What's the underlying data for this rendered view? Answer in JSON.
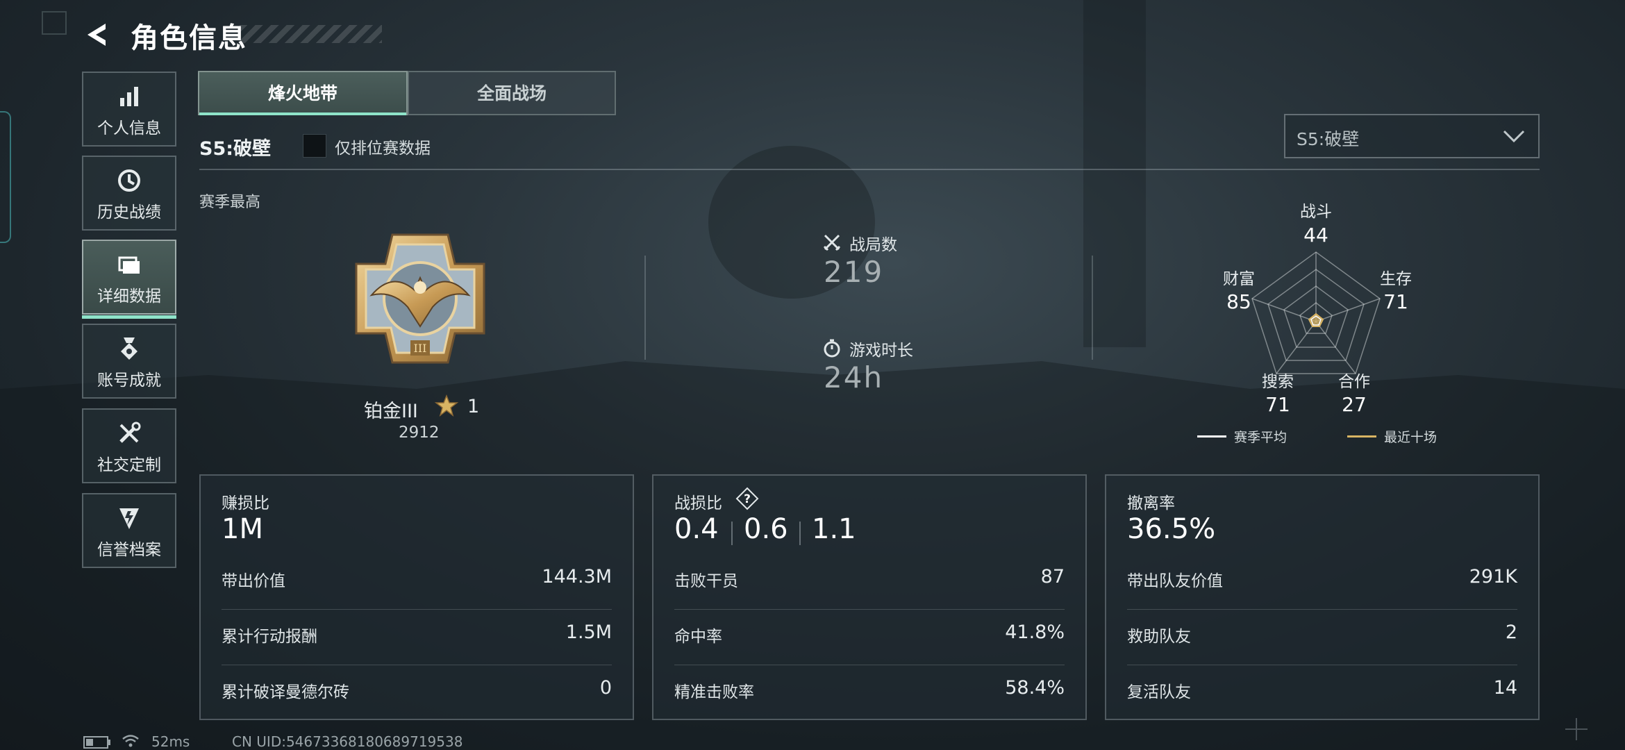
{
  "header": {
    "title": "角色信息"
  },
  "sidebar": {
    "items": [
      {
        "label": "个人信息",
        "icon": "bar-chart-icon"
      },
      {
        "label": "历史战绩",
        "icon": "history-clock-icon"
      },
      {
        "label": "详细数据",
        "icon": "folder-icon",
        "active": true
      },
      {
        "label": "账号成就",
        "icon": "medal-icon"
      },
      {
        "label": "社交定制",
        "icon": "tools-icon"
      },
      {
        "label": "信誉档案",
        "icon": "shield-bolt-icon"
      }
    ]
  },
  "tabs": [
    {
      "label": "烽火地带",
      "active": true
    },
    {
      "label": "全面战场",
      "active": false
    }
  ],
  "season": {
    "label": "S5:破壁",
    "ranked_only_label": "仅排位赛数据",
    "ranked_only_checked": false,
    "select_value": "S5:破壁"
  },
  "overview": {
    "section_label": "赛季最高",
    "rank_name": "铂金III",
    "star_count": "1",
    "rank_score": "2912",
    "matches_label": "战局数",
    "matches_value": "219",
    "playtime_label": "游戏时长",
    "playtime_value": "24h"
  },
  "radar": {
    "axes": [
      {
        "label": "战斗",
        "value": "44"
      },
      {
        "label": "生存",
        "value": "71"
      },
      {
        "label": "合作",
        "value": "27"
      },
      {
        "label": "搜索",
        "value": "71"
      },
      {
        "label": "财富",
        "value": "85"
      }
    ],
    "legend": [
      {
        "label": "赛季平均",
        "color": "#ffffff"
      },
      {
        "label": "最近十场",
        "color": "#d8b463"
      }
    ]
  },
  "cards": [
    {
      "title": "赚损比",
      "big": "1M",
      "rows": [
        {
          "label": "带出价值",
          "value": "144.3M"
        },
        {
          "label": "累计行动报酬",
          "value": "1.5M"
        },
        {
          "label": "累计破译曼德尔砖",
          "value": "0"
        }
      ]
    },
    {
      "title": "战损比",
      "big_parts": [
        "0.4",
        "0.6",
        "1.1"
      ],
      "help_icon": "question-icon",
      "rows": [
        {
          "label": "击败干员",
          "value": "87"
        },
        {
          "label": "命中率",
          "value": "41.8%"
        },
        {
          "label": "精准击败率",
          "value": "58.4%"
        }
      ]
    },
    {
      "title": "撤离率",
      "big": "36.5%",
      "rows": [
        {
          "label": "带出队友价值",
          "value": "291K"
        },
        {
          "label": "救助队友",
          "value": "2"
        },
        {
          "label": "复活队友",
          "value": "14"
        }
      ]
    }
  ],
  "footer": {
    "ping": "52ms",
    "uid": "CN UID:5467336818068971953​8"
  },
  "colors": {
    "accent": "#8fe3c9",
    "gold": "#d8b463"
  }
}
